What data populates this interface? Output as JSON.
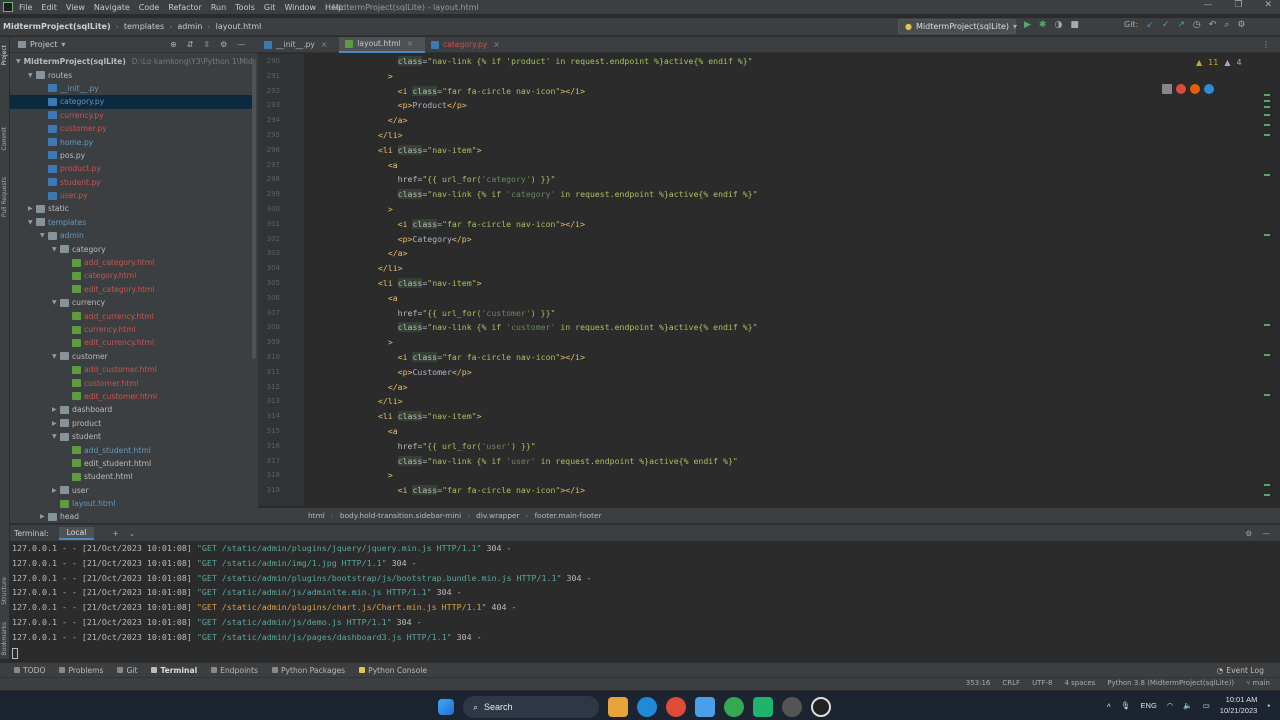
{
  "menu": {
    "items": [
      "File",
      "Edit",
      "View",
      "Navigate",
      "Code",
      "Refactor",
      "Run",
      "Tools",
      "Git",
      "Window",
      "Help"
    ],
    "window_title": "MidtermProject(sqlLite) - layout.html",
    "controls": [
      "—",
      "❐",
      "✕"
    ]
  },
  "navbar": {
    "crumbs": [
      "MidtermProject(sqlLite)",
      "templates",
      "admin",
      "layout.html"
    ],
    "run_config": "MidtermProject(sqlLite)",
    "git_label": "Git:"
  },
  "project": {
    "title": "Project",
    "root_path": "D:\\Lo kamkong\\Y3\\Python 1\\Midt",
    "tree": [
      {
        "label": "MidtermProject(sqlLite)",
        "type": "root",
        "depth": 0,
        "open": true,
        "state": ""
      },
      {
        "label": "routes",
        "type": "folder",
        "depth": 1,
        "open": true,
        "state": ""
      },
      {
        "label": "__init__.py",
        "type": "py",
        "depth": 2,
        "state": "mod"
      },
      {
        "label": "category.py",
        "type": "py",
        "depth": 2,
        "state": "mod",
        "selected": true
      },
      {
        "label": "currency.py",
        "type": "py",
        "depth": 2,
        "state": "new"
      },
      {
        "label": "customer.py",
        "type": "py",
        "depth": 2,
        "state": "new"
      },
      {
        "label": "home.py",
        "type": "py",
        "depth": 2,
        "state": "mod"
      },
      {
        "label": "pos.py",
        "type": "py",
        "depth": 2,
        "state": ""
      },
      {
        "label": "product.py",
        "type": "py",
        "depth": 2,
        "state": "new"
      },
      {
        "label": "student.py",
        "type": "py",
        "depth": 2,
        "state": "new"
      },
      {
        "label": "user.py",
        "type": "py",
        "depth": 2,
        "state": "new"
      },
      {
        "label": "static",
        "type": "folder",
        "depth": 1,
        "open": false,
        "state": ""
      },
      {
        "label": "templates",
        "type": "folder",
        "depth": 1,
        "open": true,
        "state": "mod"
      },
      {
        "label": "admin",
        "type": "folder",
        "depth": 2,
        "open": true,
        "state": "mod"
      },
      {
        "label": "category",
        "type": "folder",
        "depth": 3,
        "open": true,
        "state": ""
      },
      {
        "label": "add_category.html",
        "type": "html",
        "depth": 4,
        "state": "new"
      },
      {
        "label": "category.html",
        "type": "html",
        "depth": 4,
        "state": "new"
      },
      {
        "label": "edit_category.html",
        "type": "html",
        "depth": 4,
        "state": "new"
      },
      {
        "label": "currency",
        "type": "folder",
        "depth": 3,
        "open": true,
        "state": ""
      },
      {
        "label": "add_currency.html",
        "type": "html",
        "depth": 4,
        "state": "new"
      },
      {
        "label": "currency.html",
        "type": "html",
        "depth": 4,
        "state": "new"
      },
      {
        "label": "edit_currency.html",
        "type": "html",
        "depth": 4,
        "state": "new"
      },
      {
        "label": "customer",
        "type": "folder",
        "depth": 3,
        "open": true,
        "state": ""
      },
      {
        "label": "add_customer.html",
        "type": "html",
        "depth": 4,
        "state": "new"
      },
      {
        "label": "customer.html",
        "type": "html",
        "depth": 4,
        "state": "new"
      },
      {
        "label": "edit_customer.html",
        "type": "html",
        "depth": 4,
        "state": "new"
      },
      {
        "label": "dashboard",
        "type": "folder",
        "depth": 3,
        "open": false,
        "state": ""
      },
      {
        "label": "product",
        "type": "folder",
        "depth": 3,
        "open": false,
        "state": ""
      },
      {
        "label": "student",
        "type": "folder",
        "depth": 3,
        "open": true,
        "state": ""
      },
      {
        "label": "add_student.html",
        "type": "html",
        "depth": 4,
        "state": "mod"
      },
      {
        "label": "edit_student.html",
        "type": "html",
        "depth": 4,
        "state": ""
      },
      {
        "label": "student.html",
        "type": "html",
        "depth": 4,
        "state": ""
      },
      {
        "label": "user",
        "type": "folder",
        "depth": 3,
        "open": false,
        "state": ""
      },
      {
        "label": "layout.html",
        "type": "html",
        "depth": 3,
        "state": "mod"
      },
      {
        "label": "head",
        "type": "folder",
        "depth": 2,
        "open": false,
        "state": ""
      }
    ]
  },
  "editor": {
    "tabs": [
      {
        "label": "__init__.py",
        "icon": "py",
        "active": false,
        "state": ""
      },
      {
        "label": "layout.html",
        "icon": "html",
        "active": true,
        "state": ""
      },
      {
        "label": "category.py",
        "icon": "py",
        "active": false,
        "state": "new"
      }
    ],
    "line_numbers": [
      "290",
      "291",
      "292",
      "293",
      "294",
      "295",
      "296",
      "297",
      "298",
      "299",
      "300",
      "301",
      "302",
      "303",
      "304",
      "305",
      "306",
      "307",
      "308",
      "309",
      "310",
      "311",
      "312",
      "313",
      "314",
      "315",
      "316",
      "317",
      "318",
      "319"
    ],
    "inspection": {
      "warnings": "11",
      "weak_warnings": "4"
    },
    "breadcrumbs": [
      "html",
      "body.hold-transition.sidebar-mini",
      "div.wrapper",
      "footer.main-footer"
    ]
  },
  "terminal": {
    "tab_label": "Terminal:",
    "session": "Local",
    "lines": [
      {
        "prefix": "127.0.0.1 - - [21/Oct/2023 10:01:08] ",
        "request": "\"GET /static/admin/plugins/jquery/jquery.min.js HTTP/1.1\"",
        "code": " 304 -",
        "status": "304"
      },
      {
        "prefix": "127.0.0.1 - - [21/Oct/2023 10:01:08] ",
        "request": "\"GET /static/admin/img/1.jpg HTTP/1.1\"",
        "code": " 304 -",
        "status": "304"
      },
      {
        "prefix": "127.0.0.1 - - [21/Oct/2023 10:01:08] ",
        "request": "\"GET /static/admin/plugins/bootstrap/js/bootstrap.bundle.min.js HTTP/1.1\"",
        "code": " 304 -",
        "status": "304"
      },
      {
        "prefix": "127.0.0.1 - - [21/Oct/2023 10:01:08] ",
        "request": "\"GET /static/admin/js/adminlte.min.js HTTP/1.1\"",
        "code": " 304 -",
        "status": "304"
      },
      {
        "prefix": "127.0.0.1 - - [21/Oct/2023 10:01:08] ",
        "request": "\"GET /static/admin/plugins/chart.js/Chart.min.js HTTP/1.1\"",
        "code": " 404 -",
        "status": "404"
      },
      {
        "prefix": "127.0.0.1 - - [21/Oct/2023 10:01:08] ",
        "request": "\"GET /static/admin/js/demo.js HTTP/1.1\"",
        "code": " 304 -",
        "status": "304"
      },
      {
        "prefix": "127.0.0.1 - - [21/Oct/2023 10:01:08] ",
        "request": "\"GET /static/admin/js/pages/dashboard3.js HTTP/1.1\"",
        "code": " 304 -",
        "status": "304"
      }
    ]
  },
  "tool_windows": [
    "TODO",
    "Problems",
    "Git",
    "Terminal",
    "Endpoints",
    "Python Packages",
    "Python Console"
  ],
  "event_log": "Event Log",
  "status_bar": {
    "position": "353:16",
    "line_sep": "CRLF",
    "encoding": "UTF-8",
    "indent": "4 spaces",
    "interpreter": "Python 3.8 (MidtermProject(sqlLite))",
    "branch": "main"
  },
  "taskbar": {
    "search": "Search",
    "lang": "ENG",
    "time": "10:01 AM",
    "date": "10/21/2023"
  },
  "colors": {
    "ide_bg": "#2b2b2b",
    "panel_bg": "#3c3f41",
    "selection": "#0d293e",
    "accent": "#4a88c7",
    "taskbar": "#1c2431"
  }
}
